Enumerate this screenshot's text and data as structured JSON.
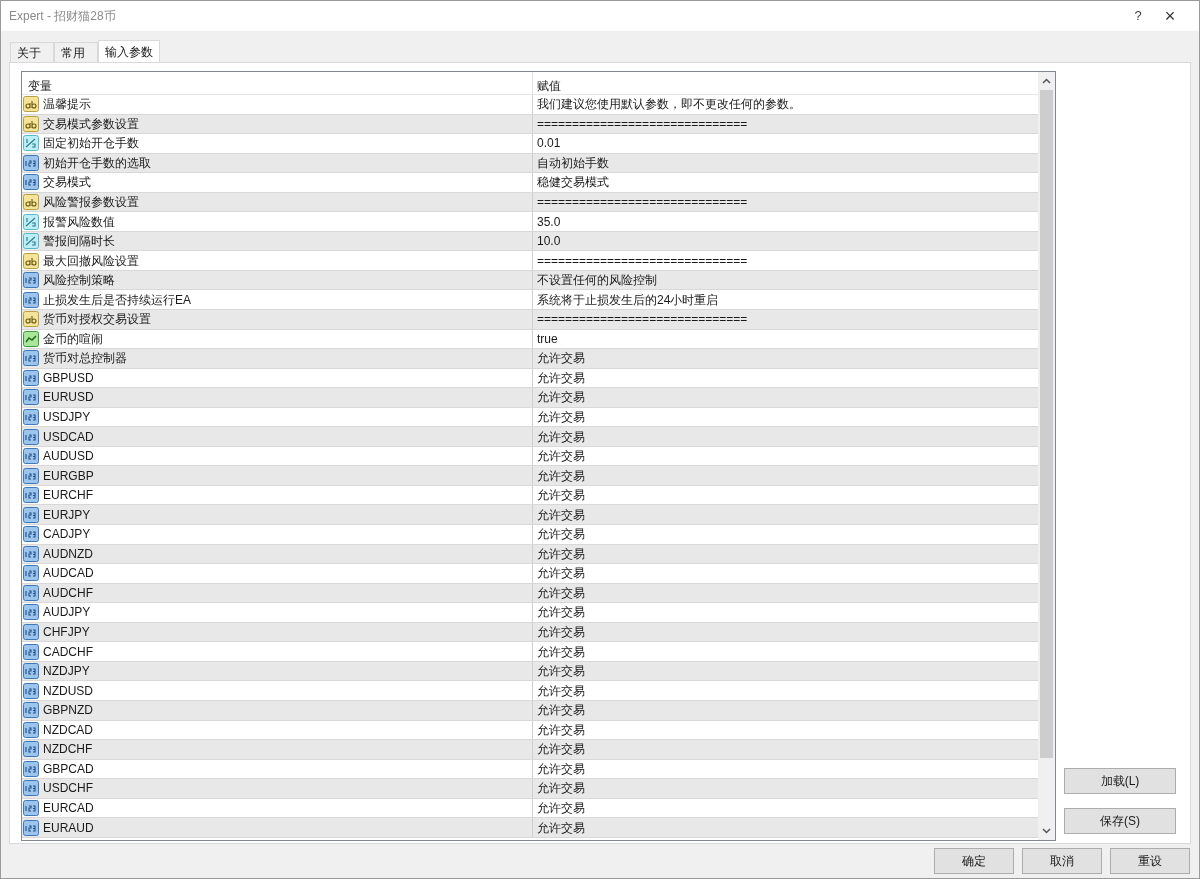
{
  "window": {
    "title": "Expert - 招财猫28币",
    "help": "?",
    "close": "×"
  },
  "tabs": [
    {
      "label": "关于",
      "selected": false
    },
    {
      "label": "常用",
      "selected": false
    },
    {
      "label": "输入参数",
      "selected": true
    }
  ],
  "table": {
    "columns": [
      "变量",
      "赋值"
    ],
    "rows": [
      {
        "kind": "string",
        "name": "温馨提示",
        "value": "我们建议您使用默认参数，即不更改任何的参数。"
      },
      {
        "kind": "string",
        "name": "交易模式参数设置",
        "value": "=============================="
      },
      {
        "kind": "double",
        "name": "固定初始开仓手数",
        "value": "0.01"
      },
      {
        "kind": "int",
        "name": "初始开仓手数的选取",
        "value": "自动初始手数"
      },
      {
        "kind": "int",
        "name": "交易模式",
        "value": "稳健交易模式"
      },
      {
        "kind": "string",
        "name": "风险警报参数设置",
        "value": "=============================="
      },
      {
        "kind": "double",
        "name": "报警风险数值",
        "value": "35.0"
      },
      {
        "kind": "double",
        "name": "警报间隔时长",
        "value": "10.0"
      },
      {
        "kind": "string",
        "name": "最大回撤风险设置",
        "value": "=============================="
      },
      {
        "kind": "int",
        "name": "风险控制策略",
        "value": "不设置任何的风险控制"
      },
      {
        "kind": "int",
        "name": "止损发生后是否持续运行EA",
        "value": "系统将于止损发生后的24小时重启"
      },
      {
        "kind": "string",
        "name": "货币对授权交易设置",
        "value": "=============================="
      },
      {
        "kind": "bool",
        "name": "金币的喧闹",
        "value": "true"
      },
      {
        "kind": "int",
        "name": "货币对总控制器",
        "value": "允许交易"
      },
      {
        "kind": "int",
        "name": "GBPUSD",
        "value": "允许交易"
      },
      {
        "kind": "int",
        "name": "EURUSD",
        "value": "允许交易"
      },
      {
        "kind": "int",
        "name": "USDJPY",
        "value": "允许交易"
      },
      {
        "kind": "int",
        "name": "USDCAD",
        "value": "允许交易"
      },
      {
        "kind": "int",
        "name": "AUDUSD",
        "value": "允许交易"
      },
      {
        "kind": "int",
        "name": "EURGBP",
        "value": "允许交易"
      },
      {
        "kind": "int",
        "name": "EURCHF",
        "value": "允许交易"
      },
      {
        "kind": "int",
        "name": "EURJPY",
        "value": "允许交易"
      },
      {
        "kind": "int",
        "name": "CADJPY",
        "value": "允许交易"
      },
      {
        "kind": "int",
        "name": "AUDNZD",
        "value": "允许交易"
      },
      {
        "kind": "int",
        "name": "AUDCAD",
        "value": "允许交易"
      },
      {
        "kind": "int",
        "name": "AUDCHF",
        "value": "允许交易"
      },
      {
        "kind": "int",
        "name": "AUDJPY",
        "value": "允许交易"
      },
      {
        "kind": "int",
        "name": "CHFJPY",
        "value": "允许交易"
      },
      {
        "kind": "int",
        "name": "CADCHF",
        "value": "允许交易"
      },
      {
        "kind": "int",
        "name": "NZDJPY",
        "value": "允许交易"
      },
      {
        "kind": "int",
        "name": "NZDUSD",
        "value": "允许交易"
      },
      {
        "kind": "int",
        "name": "GBPNZD",
        "value": "允许交易"
      },
      {
        "kind": "int",
        "name": "NZDCAD",
        "value": "允许交易"
      },
      {
        "kind": "int",
        "name": "NZDCHF",
        "value": "允许交易"
      },
      {
        "kind": "int",
        "name": "GBPCAD",
        "value": "允许交易"
      },
      {
        "kind": "int",
        "name": "USDCHF",
        "value": "允许交易"
      },
      {
        "kind": "int",
        "name": "EURCAD",
        "value": "允许交易"
      },
      {
        "kind": "int",
        "name": "EURAUD",
        "value": "允许交易"
      }
    ]
  },
  "side_buttons": [
    "加载(L)",
    "保存(S)"
  ],
  "buttons": [
    "确定",
    "取消",
    "重设"
  ]
}
